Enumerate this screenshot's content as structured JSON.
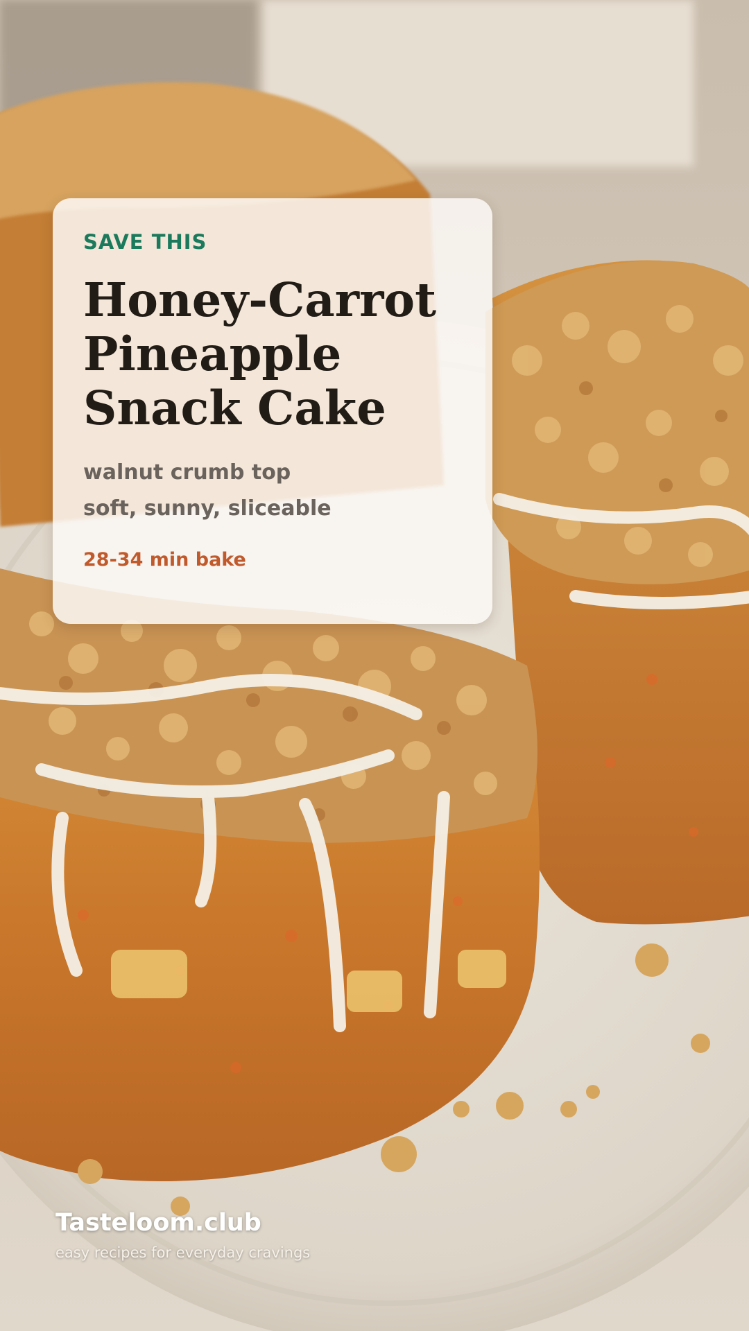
{
  "card": {
    "eyebrow": "SAVE THIS",
    "title_lines": [
      "Honey-Carrot",
      "Pineapple",
      "Snack Cake"
    ],
    "subtitle_line1": "walnut crumb top",
    "subtitle_line2": "soft, sunny, sliceable",
    "bake_time": "28-34 min bake"
  },
  "footer": {
    "brand": "Tasteloom.club",
    "tagline": "easy recipes for everyday cravings"
  },
  "colors": {
    "eyebrow": "#1b7a5c",
    "title": "#221c17",
    "subtitle": "#6a625c",
    "bake_time": "#c05a2c",
    "card_background": "#fcf8f4"
  }
}
